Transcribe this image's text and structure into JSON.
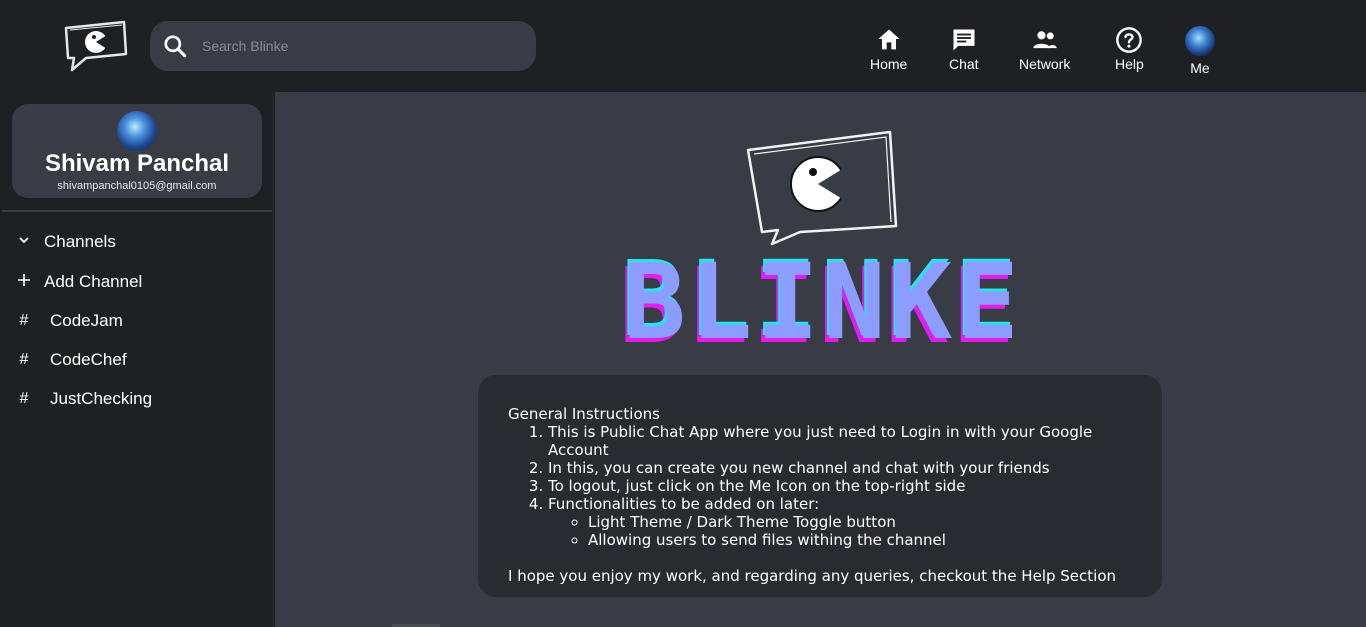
{
  "app": {
    "name": "Blinke"
  },
  "search": {
    "placeholder": "Search Blinke",
    "icon": "search-icon"
  },
  "nav": {
    "home": "Home",
    "chat": "Chat",
    "network": "Network",
    "help": "Help",
    "me": "Me"
  },
  "profile": {
    "name": "Shivam Panchal",
    "email": "shivampanchal0105@gmail.com"
  },
  "sidebar": {
    "channels_label": "Channels",
    "add_channel_label": "Add Channel",
    "channels": [
      {
        "name": "CodeJam"
      },
      {
        "name": "CodeChef"
      },
      {
        "name": "JustChecking"
      }
    ]
  },
  "main": {
    "brand_title": "BLINKE",
    "instructions": {
      "heading": "General Instructions",
      "items": [
        "This is Public Chat App where you just need to Login in with your Google Account",
        "In this, you can create you new channel and chat with your friends",
        "To logout, just click on the Me Icon on the top-right side",
        "Functionalities to be added on later:"
      ],
      "sub_items": [
        "Light Theme / Dark Theme Toggle button",
        "Allowing users to send files withing the channel"
      ],
      "closing": "I hope you enjoy my work, and regarding any queries, checkout the Help Section"
    }
  },
  "colors": {
    "background": "#1f2024",
    "panel": "#393b45",
    "card": "#2a2b31",
    "title_fill": "#8c9cff",
    "title_cyan": "#27e3f0",
    "title_magenta": "#e21cf3"
  }
}
